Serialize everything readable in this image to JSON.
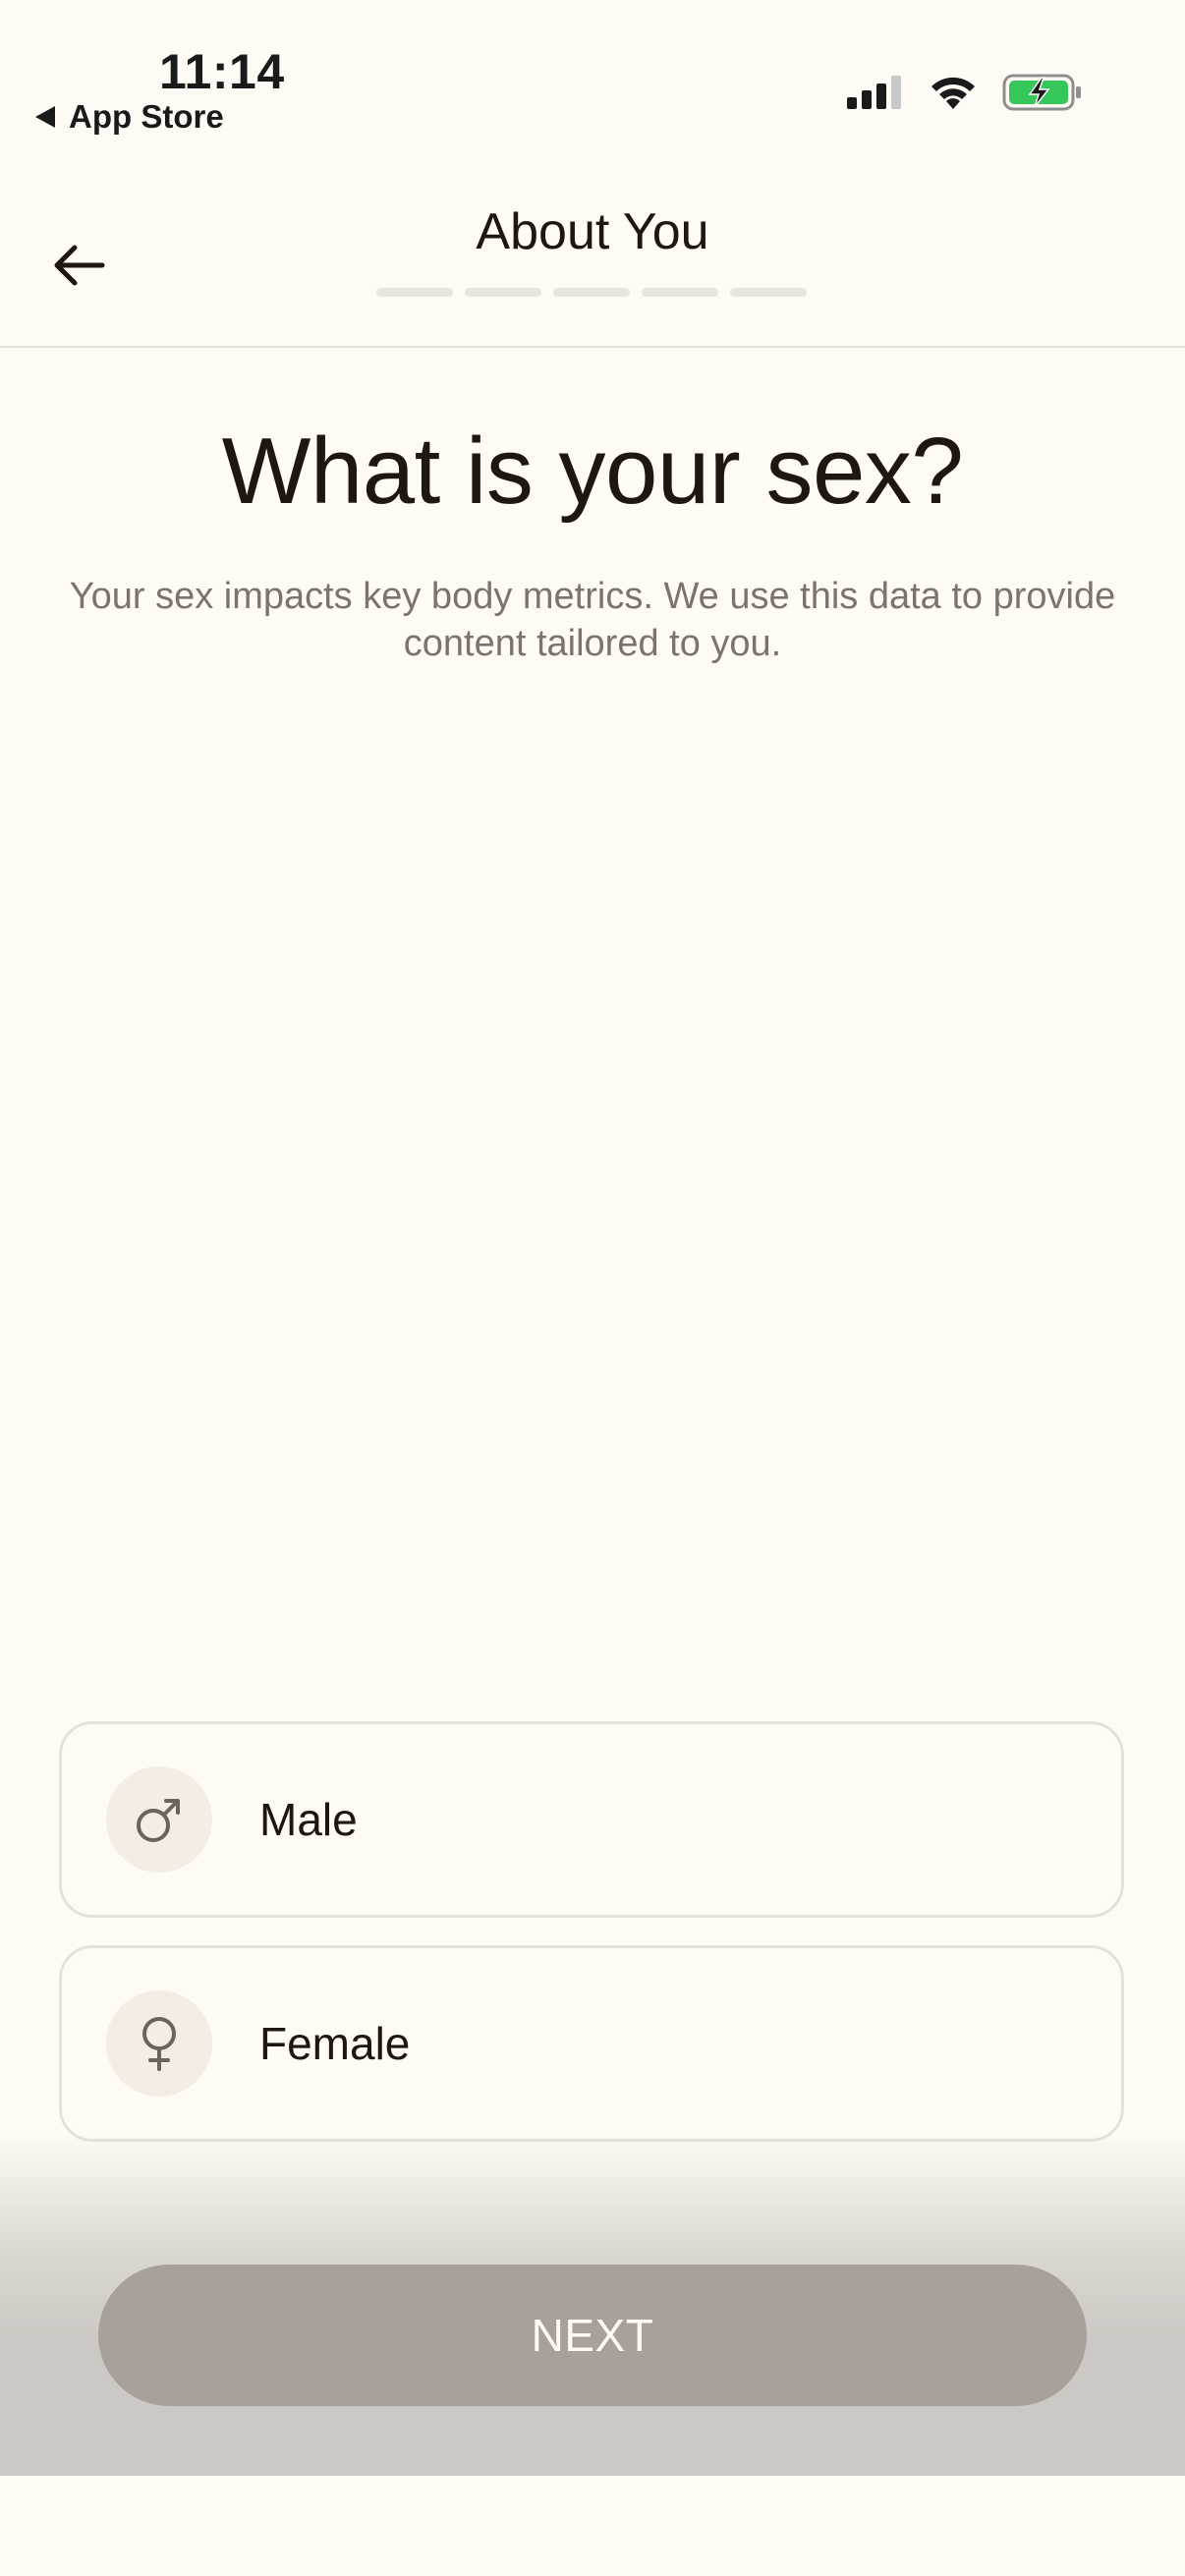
{
  "status_bar": {
    "time": "11:14",
    "back_app": "App Store"
  },
  "header": {
    "title": "About You",
    "progress_steps": 5,
    "progress_completed": 0
  },
  "main": {
    "question": "What is your sex?",
    "subtitle": "Your sex impacts key body metrics. We use this data to provide content tailored to you."
  },
  "options": [
    {
      "label": "Male",
      "icon": "male-symbol-icon"
    },
    {
      "label": "Female",
      "icon": "female-symbol-icon"
    }
  ],
  "footer": {
    "next_label": "NEXT"
  },
  "colors": {
    "background": "#fffbf4",
    "text": "#1f1610",
    "muted_text": "#7c746c",
    "border": "#e6e1d8",
    "button_disabled": "#a8a09a",
    "battery_green": "#35c759"
  }
}
